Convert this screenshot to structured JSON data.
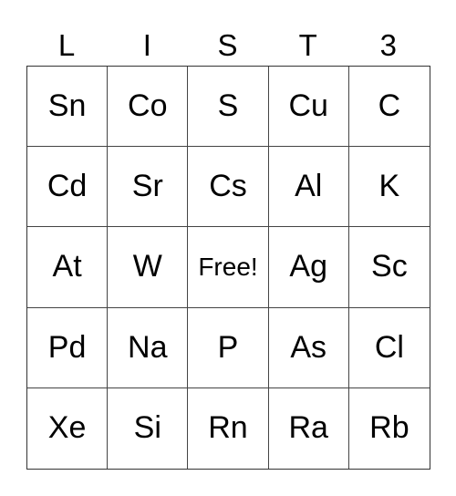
{
  "header": [
    "L",
    "I",
    "S",
    "T",
    "3"
  ],
  "rows": [
    [
      "Sn",
      "Co",
      "S",
      "Cu",
      "C"
    ],
    [
      "Cd",
      "Sr",
      "Cs",
      "Al",
      "K"
    ],
    [
      "At",
      "W",
      "Free!",
      "Ag",
      "Sc"
    ],
    [
      "Pd",
      "Na",
      "P",
      "As",
      "Cl"
    ],
    [
      "Xe",
      "Si",
      "Rn",
      "Ra",
      "Rb"
    ]
  ],
  "free_cell": {
    "row": 2,
    "col": 2
  }
}
